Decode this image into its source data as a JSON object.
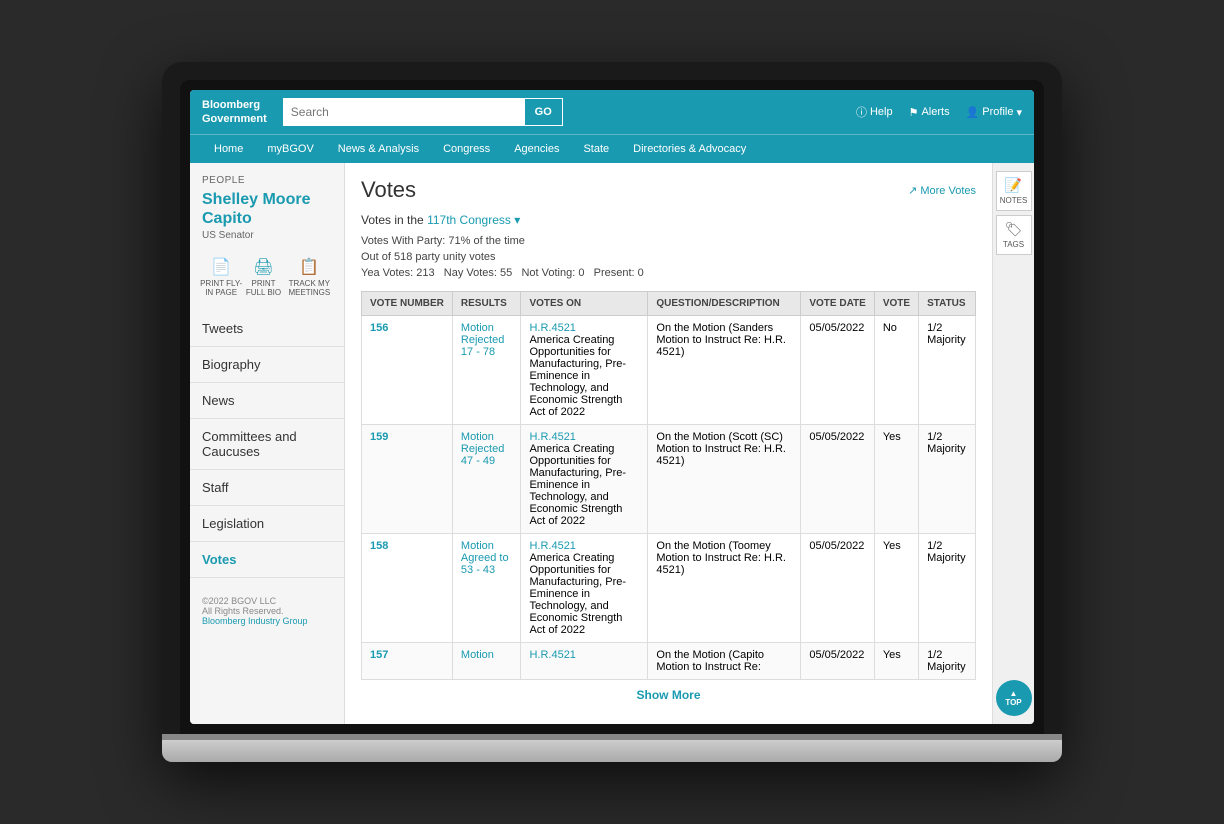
{
  "header": {
    "brand_line1": "Bloomberg",
    "brand_line2": "Government",
    "search_placeholder": "Search",
    "go_label": "GO",
    "help_label": "Help",
    "alerts_label": "Alerts",
    "profile_label": "Profile"
  },
  "nav": {
    "items": [
      {
        "label": "Home"
      },
      {
        "label": "myBGOV"
      },
      {
        "label": "News & Analysis"
      },
      {
        "label": "Congress"
      },
      {
        "label": "Agencies"
      },
      {
        "label": "State"
      },
      {
        "label": "Directories & Advocacy"
      }
    ]
  },
  "sidebar": {
    "people_label": "PEOPLE",
    "senator_name_line1": "Shelley Moore",
    "senator_name_line2": "Capito",
    "senator_title": "US Senator",
    "actions": [
      {
        "label": "PRINT FLY-IN PAGE",
        "icon": "📄"
      },
      {
        "label": "PRINT FULL BIO",
        "icon": "🖨"
      },
      {
        "label": "TRACK MY MEETINGS",
        "icon": "📋"
      }
    ],
    "nav_items": [
      {
        "label": "Tweets"
      },
      {
        "label": "Biography"
      },
      {
        "label": "News"
      },
      {
        "label": "Committees and Caucuses"
      },
      {
        "label": "Staff"
      },
      {
        "label": "Legislation"
      },
      {
        "label": "Votes",
        "active": true
      }
    ],
    "footer_line1": "©2022 BGOV LLC",
    "footer_line2": "All Rights Reserved.",
    "footer_link": "Bloomberg Industry Group"
  },
  "content": {
    "page_title": "Votes",
    "more_votes_label": "↗ More Votes",
    "congress_selector_prefix": "Votes in the",
    "congress_value": "117th Congress",
    "votes_with_party": "Votes With Party: 71% of the time",
    "out_of": "Out of 518 party unity votes",
    "yea_votes": "Yea Votes: 213",
    "nay_votes": "Nay Votes: 55",
    "not_voting": "Not Voting: 0",
    "present": "Present: 0",
    "table_headers": [
      "VOTE NUMBER",
      "RESULTS",
      "VOTES ON",
      "QUESTION/DESCRIPTION",
      "VOTE DATE",
      "VOTE",
      "STATUS"
    ],
    "rows": [
      {
        "vote_number": "156",
        "results": "Motion Rejected 17 - 78",
        "votes_on_link": "H.R.4521",
        "votes_on_desc": "America Creating Opportunities for Manufacturing, Pre-Eminence in Technology, and Economic Strength Act of 2022",
        "question": "On the Motion (Sanders Motion to Instruct Re: H.R. 4521)",
        "vote_date": "05/05/2022",
        "vote": "No",
        "status": "1/2 Majority"
      },
      {
        "vote_number": "159",
        "results": "Motion Rejected 47 - 49",
        "votes_on_link": "H.R.4521",
        "votes_on_desc": "America Creating Opportunities for Manufacturing, Pre-Eminence in Technology, and Economic Strength Act of 2022",
        "question": "On the Motion (Scott (SC) Motion to Instruct Re: H.R. 4521)",
        "vote_date": "05/05/2022",
        "vote": "Yes",
        "status": "1/2 Majority"
      },
      {
        "vote_number": "158",
        "results": "Motion Agreed to 53 - 43",
        "votes_on_link": "H.R.4521",
        "votes_on_desc": "America Creating Opportunities for Manufacturing, Pre-Eminence in Technology, and Economic Strength Act of 2022",
        "question": "On the Motion (Toomey Motion to Instruct Re: H.R. 4521)",
        "vote_date": "05/05/2022",
        "vote": "Yes",
        "status": "1/2 Majority"
      },
      {
        "vote_number": "157",
        "results": "Motion",
        "votes_on_link": "H.R.4521",
        "votes_on_desc": "",
        "question": "On the Motion (Capito Motion to Instruct Re:",
        "vote_date": "05/05/2022",
        "vote": "Yes",
        "status": "1/2 Majority"
      }
    ],
    "show_more_label": "Show More"
  },
  "right_panel": {
    "notes_label": "NOTES",
    "tags_label": "TAGS",
    "top_label": "TOP"
  }
}
